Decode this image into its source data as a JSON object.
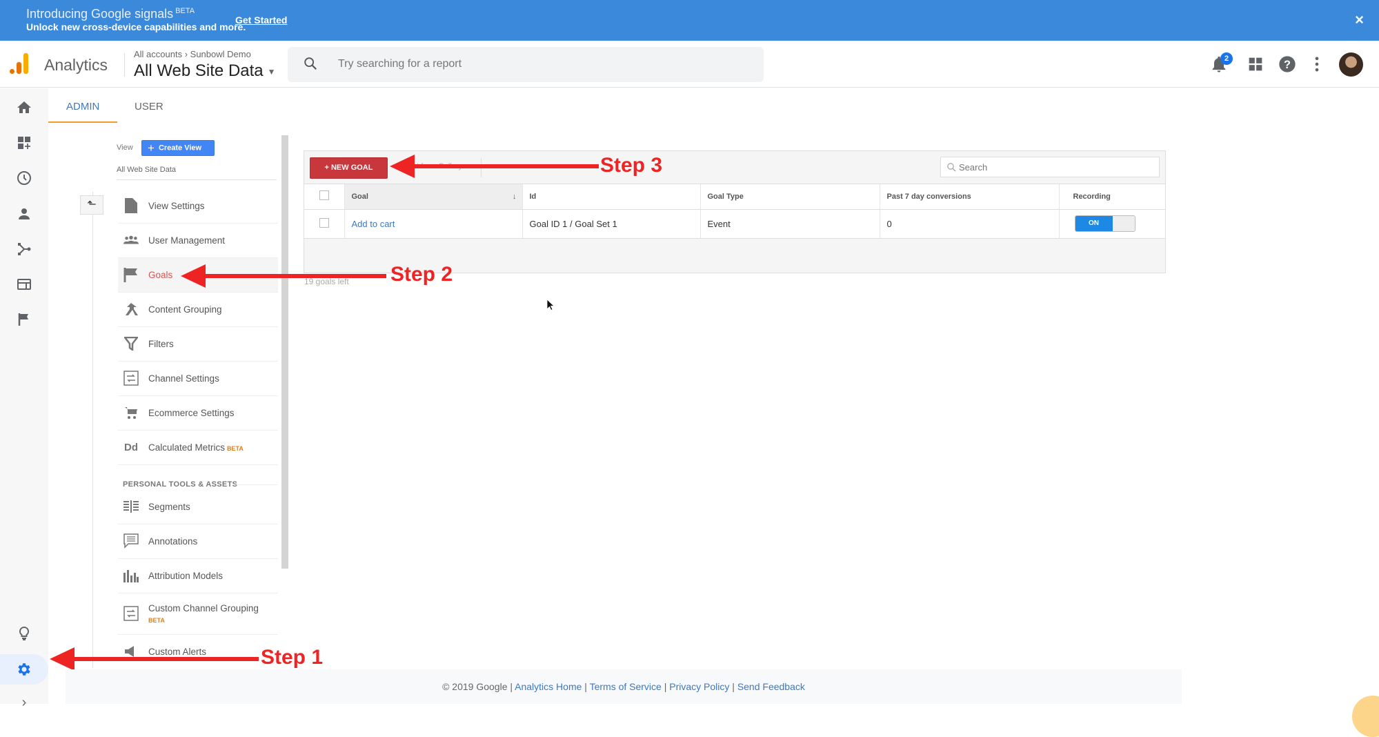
{
  "banner": {
    "title": "Introducing Google signals",
    "title_badge": "BETA",
    "subtitle": "Unlock new cross-device capabilities and more.",
    "cta": "Get Started",
    "close": "×"
  },
  "header": {
    "app_name": "Analytics",
    "breadcrumb": "All accounts › Sunbowl Demo",
    "property": "All Web Site Data",
    "search_placeholder": "Try searching for a report",
    "notification_count": "2",
    "icons": [
      "notifications-icon",
      "apps-icon",
      "help-icon",
      "more-vert-icon",
      "avatar"
    ]
  },
  "left_nav": {
    "icons": [
      "home-icon",
      "customization-icon",
      "realtime-icon",
      "audience-icon",
      "acquisition-icon",
      "behavior-icon",
      "conversions-icon",
      "discover-icon",
      "admin-gear-icon",
      "expand-icon"
    ],
    "active": "admin-gear-icon"
  },
  "tabs": [
    {
      "label": "ADMIN",
      "active": true
    },
    {
      "label": "USER",
      "active": false
    }
  ],
  "view_column": {
    "label": "View",
    "create_button": "Create View",
    "view_name": "All Web Site Data",
    "items": [
      {
        "label": "View Settings",
        "icon": "document-icon"
      },
      {
        "label": "User Management",
        "icon": "people-icon"
      },
      {
        "label": "Goals",
        "icon": "flag-icon",
        "active": true
      },
      {
        "label": "Content Grouping",
        "icon": "merge-icon"
      },
      {
        "label": "Filters",
        "icon": "filter-icon"
      },
      {
        "label": "Channel Settings",
        "icon": "channel-icon"
      },
      {
        "label": "Ecommerce Settings",
        "icon": "cart-icon"
      },
      {
        "label": "Calculated Metrics",
        "icon": "dd-icon",
        "badge": "BETA"
      }
    ],
    "section_header": "PERSONAL TOOLS & ASSETS",
    "personal_items": [
      {
        "label": "Segments",
        "icon": "segments-icon"
      },
      {
        "label": "Annotations",
        "icon": "annotation-icon"
      },
      {
        "label": "Attribution Models",
        "icon": "bar-chart-icon"
      },
      {
        "label": "Custom Channel Grouping",
        "icon": "channel-icon",
        "badge": "BETA"
      },
      {
        "label": "Custom Alerts",
        "icon": "megaphone-icon"
      }
    ]
  },
  "goals_panel": {
    "new_goal_button": "+ NEW GOAL",
    "import_button": "Import from Gallery",
    "search_placeholder": "Search",
    "columns": [
      "Goal",
      "Id",
      "Goal Type",
      "Past 7 day conversions",
      "Recording"
    ],
    "rows": [
      {
        "goal": "Add to cart",
        "id": "Goal ID 1 / Goal Set 1",
        "type": "Event",
        "conversions": "0",
        "recording": "ON"
      }
    ],
    "goals_left": "19 goals left"
  },
  "annotations": [
    {
      "label": "Step 1"
    },
    {
      "label": "Step 2"
    },
    {
      "label": "Step 3"
    }
  ],
  "footer": {
    "copyright": "© 2019 Google",
    "links": [
      "Analytics Home",
      "Terms of Service",
      "Privacy Policy",
      "Send Feedback"
    ]
  },
  "colors": {
    "banner": "#3b89db",
    "accent_blue": "#4285f4",
    "new_goal_red": "#c7373c",
    "tab_underline": "#f29b2b",
    "annotation_red": "#ee2424",
    "toggle_on": "#1e88e5"
  }
}
